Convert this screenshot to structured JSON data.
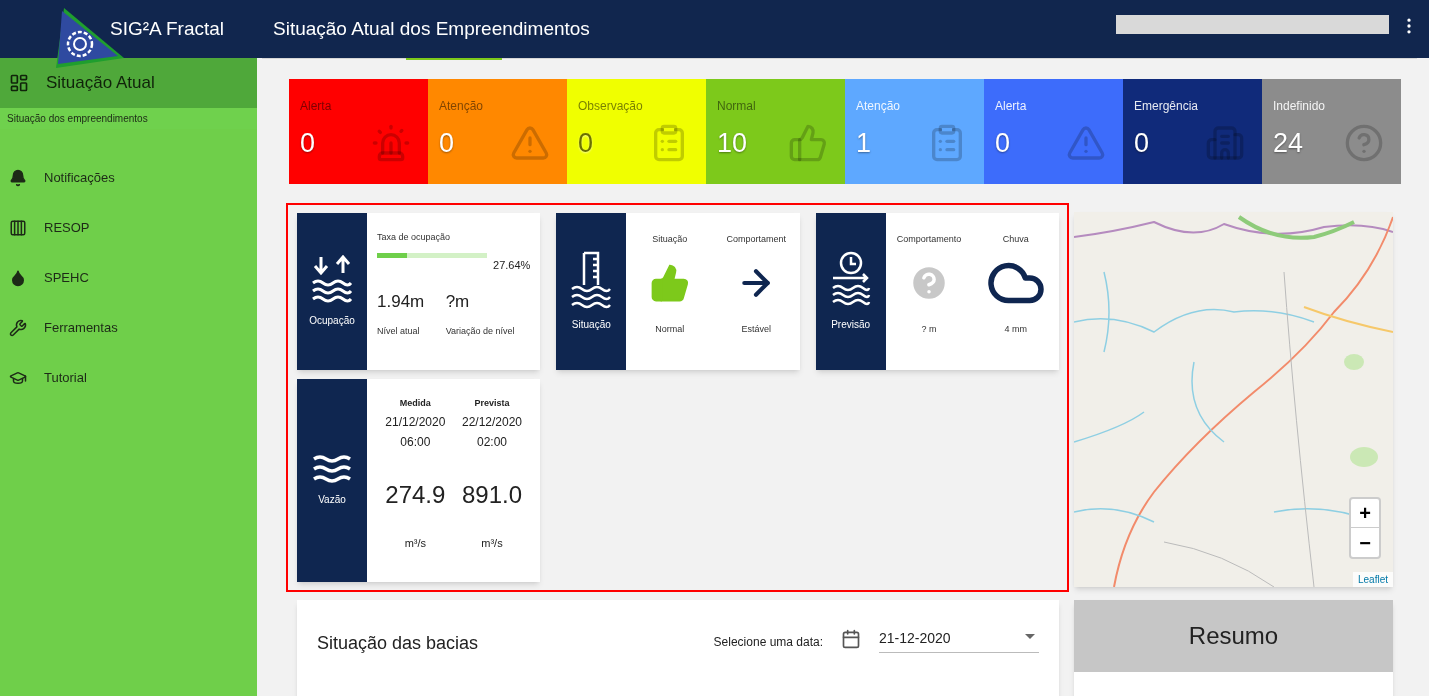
{
  "header": {
    "app_title": "SIG²A Fractal",
    "page_title": "Situação Atual dos Empreendimentos"
  },
  "sidebar": {
    "items": [
      {
        "label": "Situação Atual",
        "subtitle": "Situação dos empreendimentos",
        "kind": "dashboard",
        "selected": true
      },
      {
        "label": "Notificações",
        "kind": "bell",
        "selected": false
      },
      {
        "label": "RESOP",
        "kind": "columns",
        "selected": false
      },
      {
        "label": "SPEHC",
        "kind": "drop",
        "selected": false
      },
      {
        "label": "Ferramentas",
        "kind": "wrench",
        "selected": false
      },
      {
        "label": "Tutorial",
        "kind": "school",
        "selected": false
      }
    ]
  },
  "status_tiles": [
    {
      "label": "Alerta",
      "count": "0",
      "color": "#ff0000",
      "kind": "siren"
    },
    {
      "label": "Atenção",
      "count": "0",
      "color": "#ff8800",
      "kind": "warning"
    },
    {
      "label": "Observação",
      "count": "0",
      "color": "#f0ff00",
      "kind": "clipboard"
    },
    {
      "label": "Normal",
      "count": "10",
      "color": "#7dc91b",
      "kind": "thumbs_up"
    },
    {
      "label": "Atenção",
      "count": "1",
      "color": "#5ea8ff",
      "kind": "clipboard"
    },
    {
      "label": "Alerta",
      "count": "0",
      "color": "#3d6cfb",
      "kind": "warning"
    },
    {
      "label": "Emergência",
      "count": "0",
      "color": "#102a7a",
      "kind": "flood"
    },
    {
      "label": "Indefinido",
      "count": "24",
      "color": "#8c8c8c",
      "kind": "question"
    }
  ],
  "cards": [
    {
      "kind": "occupancy",
      "title": "Ocupação",
      "rate_label": "Taxa de ocupação",
      "level": 0.2764,
      "reading": "27.64%",
      "current_level": "1.94m",
      "current_label": "Nível atual",
      "variation": "?m",
      "variation_label": "Variação de nível"
    },
    {
      "kind": "indicators",
      "title": "Situação",
      "columns": [
        {
          "heading": "Situação",
          "kind": "thumbs_up",
          "value": "Normal"
        },
        {
          "heading": "Comportament",
          "kind": "arrow",
          "value": "Estável"
        }
      ]
    },
    {
      "kind": "indicators",
      "title": "Previsão",
      "columns": [
        {
          "heading": "Comportamento",
          "kind": "question",
          "value": "? m"
        },
        {
          "heading": "Chuva",
          "kind": "cloud",
          "value": "4 mm"
        }
      ]
    },
    {
      "kind": "flow",
      "title": "Vazão",
      "columns": [
        {
          "heading": "Medida",
          "date": "21/12/2020",
          "time": "06:00",
          "value": "274.9",
          "unit": "m³/s"
        },
        {
          "heading": "Prevista",
          "date": "22/12/2020",
          "time": "02:00",
          "value": "891.0",
          "unit": "m³/s"
        }
      ]
    }
  ],
  "map": {
    "zoom_in": "+",
    "zoom_out": "−",
    "attribution": "Leaflet"
  },
  "basins": {
    "title": "Situação das bacias",
    "date_label": "Selecione uma data:",
    "date": "21-12-2020"
  },
  "summary": {
    "title": "Resumo"
  }
}
